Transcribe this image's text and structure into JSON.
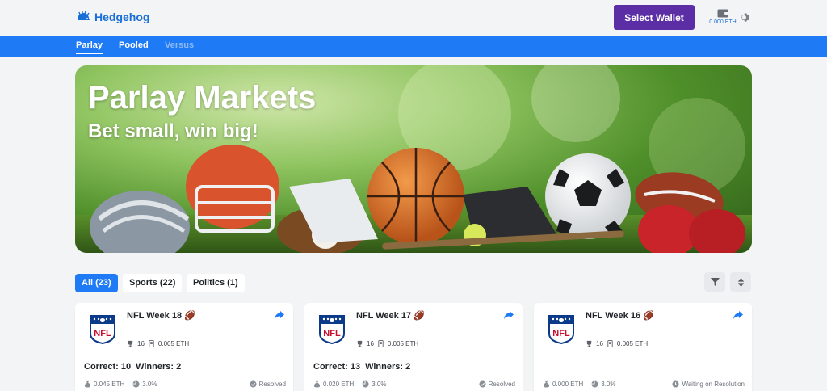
{
  "header": {
    "brand": "Hedgehog",
    "select_wallet": "Select Wallet",
    "wallet_balance": "0.000 ETH"
  },
  "nav": {
    "tabs": [
      {
        "label": "Parlay",
        "state": "active"
      },
      {
        "label": "Pooled",
        "state": "normal"
      },
      {
        "label": "Versus",
        "state": "disabled"
      }
    ]
  },
  "hero": {
    "title": "Parlay Markets",
    "subtitle": "Bet small, win big!"
  },
  "filters": {
    "chips": [
      {
        "label": "All (23)",
        "active": true
      },
      {
        "label": "Sports (22)",
        "active": false
      },
      {
        "label": "Politics (1)",
        "active": false
      }
    ]
  },
  "cards": [
    {
      "title": "NFL Week 18 🏈",
      "players": "16",
      "entry": "0.005 ETH",
      "correct": "Correct: 10",
      "winners": "Winners: 2",
      "pool": "0.045 ETH",
      "fee": "3.0%",
      "status": "Resolved"
    },
    {
      "title": "NFL Week 17 🏈",
      "players": "16",
      "entry": "0.005 ETH",
      "correct": "Correct: 13",
      "winners": "Winners: 2",
      "pool": "0.020 ETH",
      "fee": "3.0%",
      "status": "Resolved"
    },
    {
      "title": "NFL Week 16 🏈",
      "players": "16",
      "entry": "0.005 ETH",
      "correct": "",
      "winners": "",
      "pool": "0.000 ETH",
      "fee": "3.0%",
      "status": "Waiting on Resolution"
    }
  ],
  "colors": {
    "brand_blue": "#1f7bf5",
    "wallet_purple": "#5b2ea6"
  }
}
